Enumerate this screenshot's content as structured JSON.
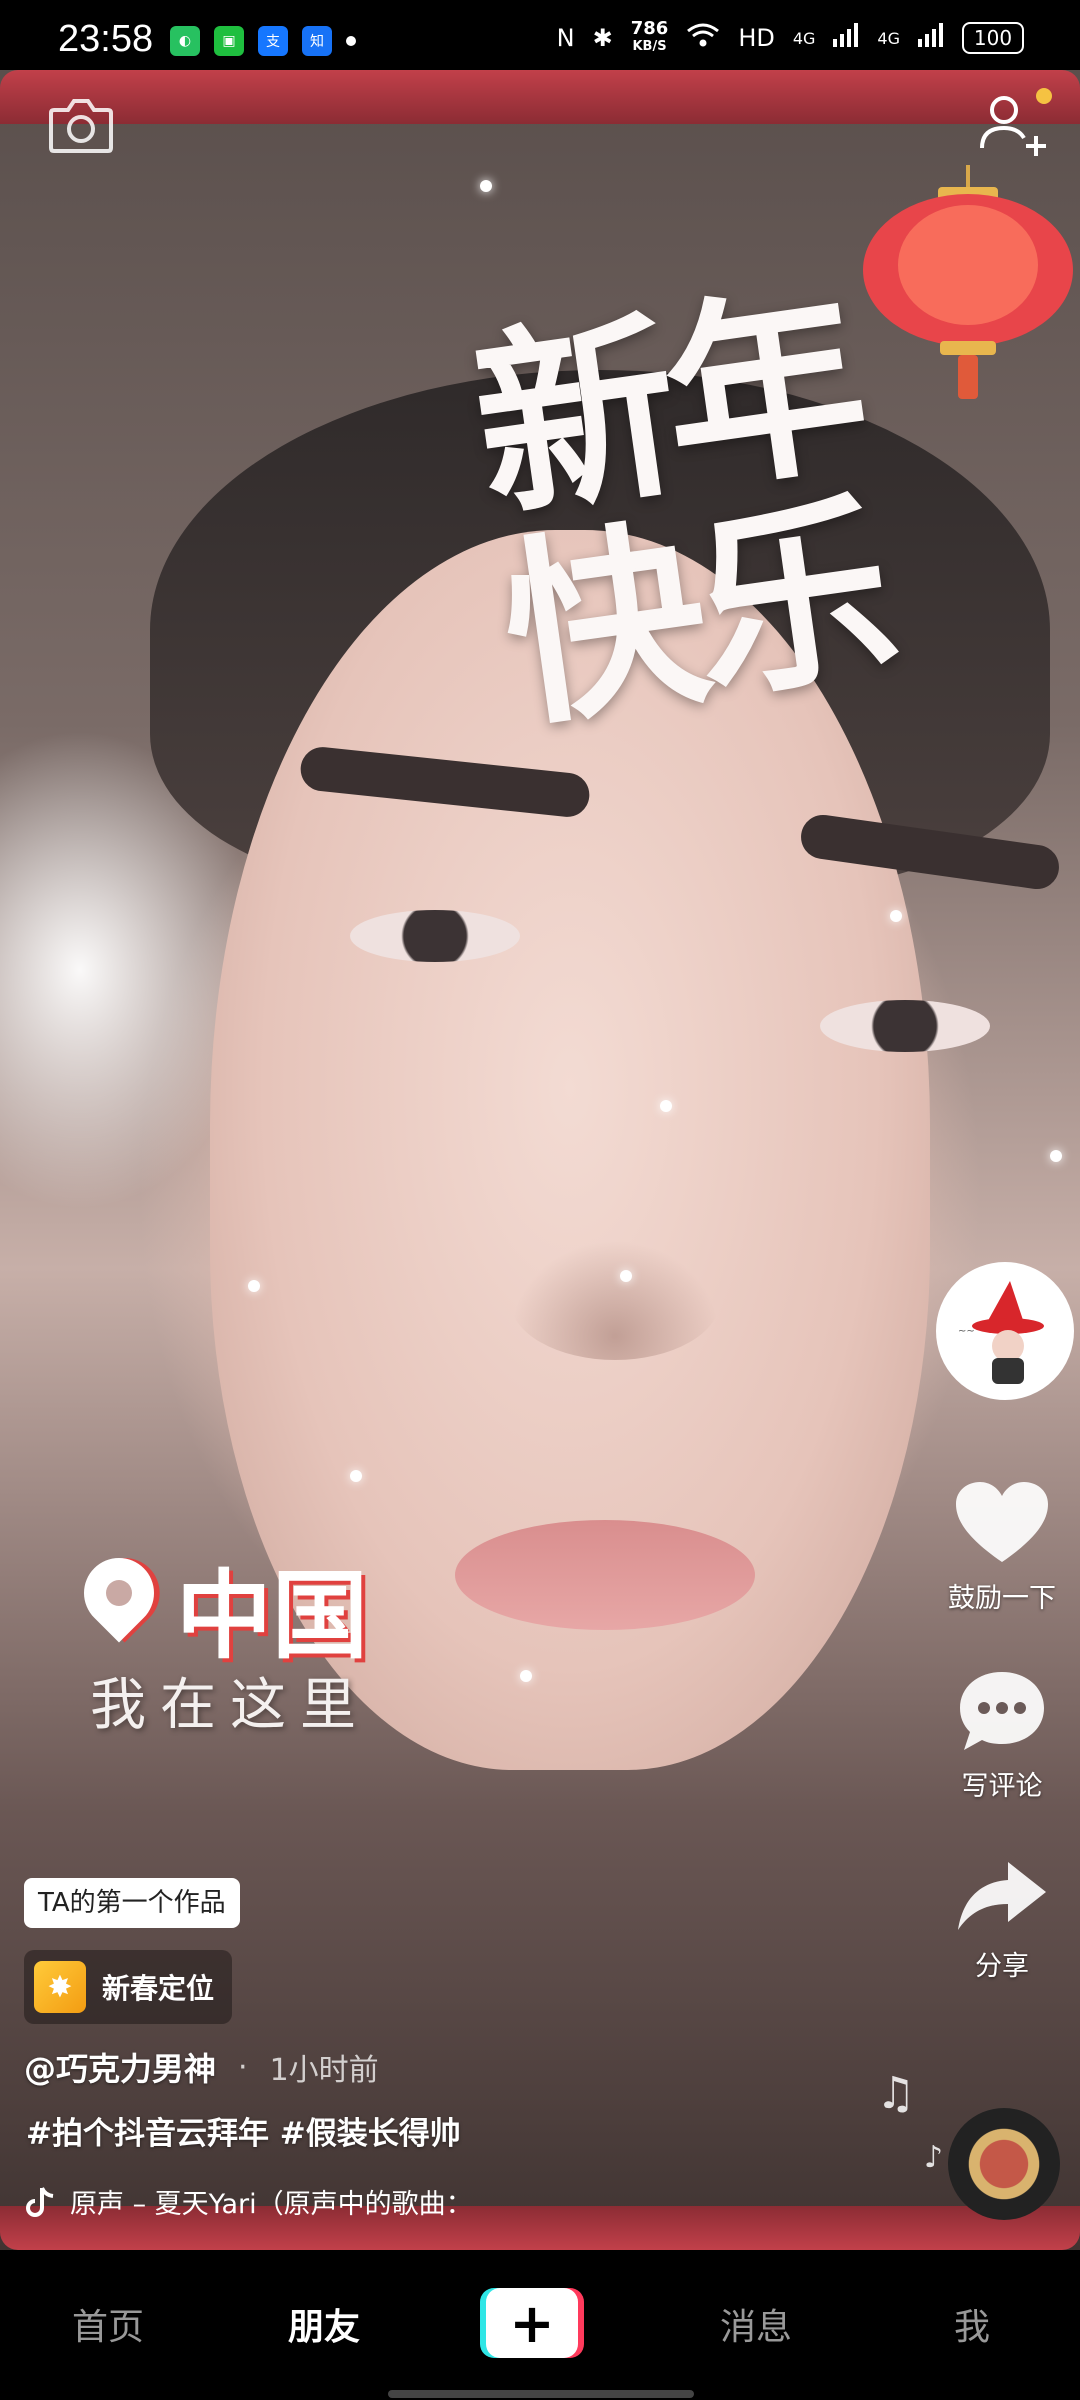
{
  "status": {
    "time": "23:58",
    "speed_value": "786",
    "speed_unit": "KB/S",
    "network_hd": "HD",
    "network_4g_1": "4G",
    "network_4g_2": "4G",
    "battery": "100",
    "apps": [
      "app-icon-green",
      "iqiyi-icon",
      "alipay-icon",
      "zhihu-icon"
    ]
  },
  "video": {
    "overlay_title": "新年快乐",
    "location_city": "中国",
    "location_sub": "我在这里"
  },
  "rail": {
    "like_label": "鼓励一下",
    "comment_label": "写评论",
    "share_label": "分享"
  },
  "info": {
    "first_work_badge": "TA的第一个作品",
    "topic_label": "新春定位",
    "author": "@巧克力男神",
    "separator": "·",
    "time_ago": "1小时前",
    "hashtags": "#拍个抖音云拜年 #假装长得帅",
    "music_text": "原声 – 夏天Yari（原声中的歌曲："
  },
  "tabs": {
    "home": "首页",
    "friends": "朋友",
    "create": "+",
    "messages": "消息",
    "me": "我"
  },
  "colors": {
    "frame_red": "#c2404a",
    "accent_cyan": "#2fe6e6",
    "accent_pink": "#ff3a5c",
    "notify_yellow": "#f5c242"
  }
}
